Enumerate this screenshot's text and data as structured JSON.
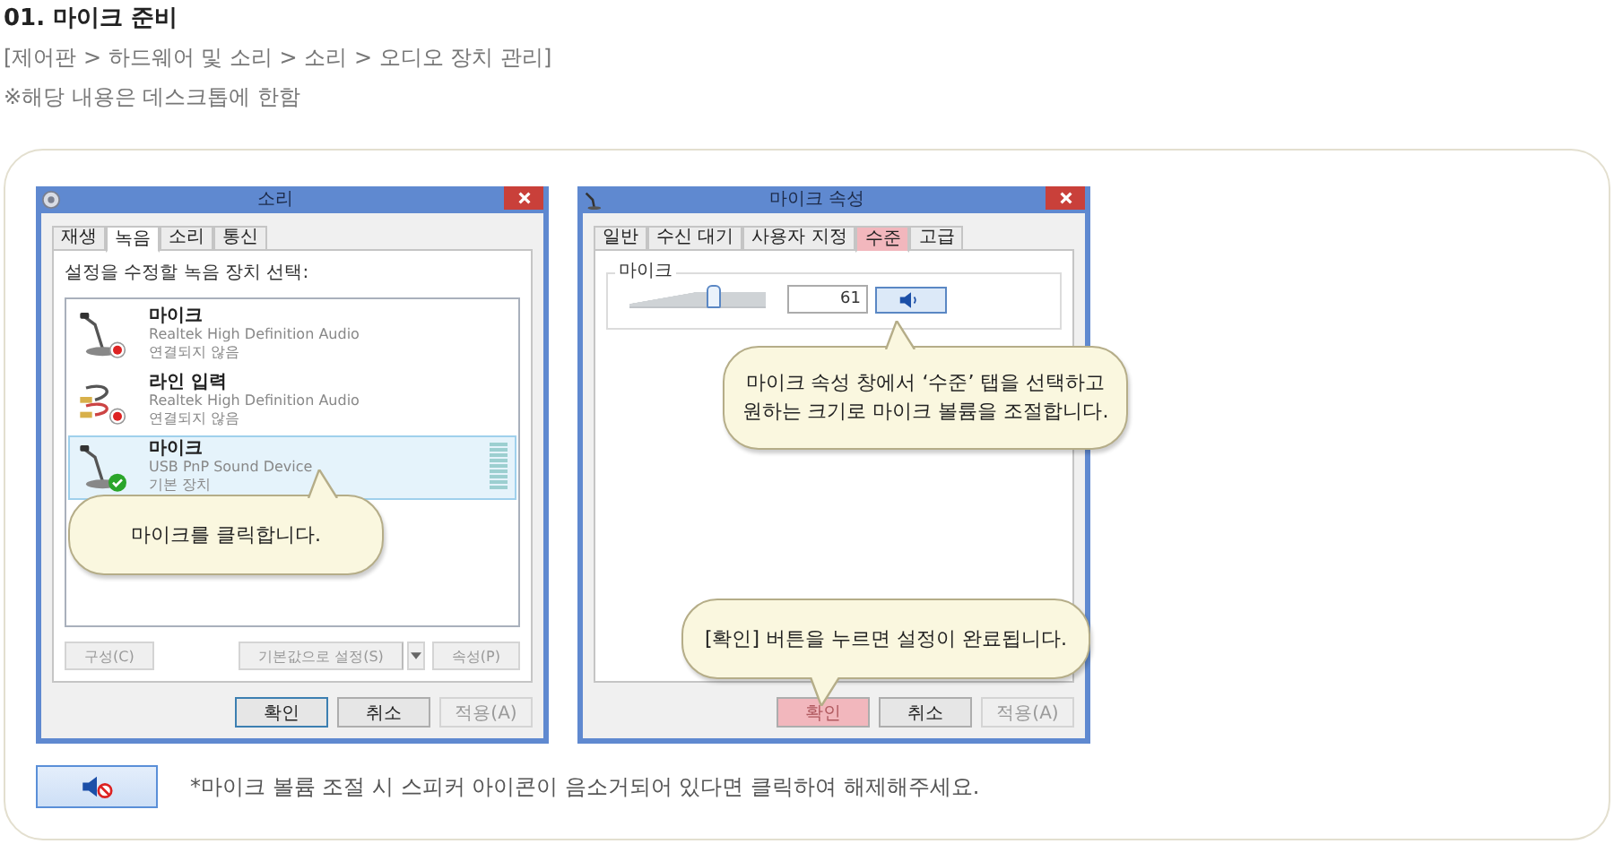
{
  "heading": {
    "title": "01. 마이크 준비",
    "path": "[제어판 > 하드웨어 및 소리 > 소리 > 오디오 장치 관리]",
    "note": "※해당 내용은 데스크톱에 한함"
  },
  "sound_window": {
    "title": "소리",
    "tabs": [
      {
        "label": "재생",
        "selected": false
      },
      {
        "label": "녹음",
        "selected": true
      },
      {
        "label": "소리",
        "selected": false
      },
      {
        "label": "통신",
        "selected": false
      }
    ],
    "instruction": "설정을 수정할 녹음 장치 선택:",
    "devices": [
      {
        "kind": "mic",
        "connected": false,
        "name": "마이크",
        "driver": "Realtek High Definition Audio",
        "status": "연결되지 않음",
        "selected": false
      },
      {
        "kind": "cable",
        "connected": false,
        "name": "라인 입력",
        "driver": "Realtek High Definition Audio",
        "status": "연결되지 않음",
        "selected": false
      },
      {
        "kind": "mic",
        "connected": true,
        "name": "마이크",
        "driver": "USB PnP Sound Device",
        "status": "기본 장치",
        "selected": true
      }
    ],
    "callouts": [
      "마이크를 클릭합니다."
    ],
    "panel_buttons": [
      {
        "label": "구성(C)",
        "disabled": true,
        "dropdown": false
      },
      {
        "label": "기본값으로 설정(S)",
        "disabled": true,
        "dropdown": true
      },
      {
        "label": "속성(P)",
        "disabled": true,
        "dropdown": false
      }
    ],
    "buttons": [
      {
        "label": "확인",
        "disabled": false,
        "default": true,
        "highlighted": false
      },
      {
        "label": "취소",
        "disabled": false,
        "default": false,
        "highlighted": false
      },
      {
        "label": "적용(A)",
        "disabled": true,
        "default": false,
        "highlighted": false
      }
    ]
  },
  "level_window": {
    "title": "마이크 속성",
    "tabs": [
      {
        "label": "일반",
        "selected": false,
        "highlighted": false
      },
      {
        "label": "수신 대기",
        "selected": false,
        "highlighted": false
      },
      {
        "label": "사용자 지정",
        "selected": false,
        "highlighted": false
      },
      {
        "label": "수준",
        "selected": true,
        "highlighted": true
      },
      {
        "label": "고급",
        "selected": false,
        "highlighted": false
      }
    ],
    "group": {
      "label": "마이크",
      "level": 0.61,
      "value": "61",
      "muted": false
    },
    "callouts": [
      "마이크 속성 창에서 ‘수준’ 탭을 선택하고 원하는 크기로 마이크 볼륨을 조절합니다.",
      "[확인] 버튼을 누르면 설정이 완료됩니다."
    ],
    "buttons": [
      {
        "label": "확인",
        "disabled": false,
        "default": false,
        "highlighted": true
      },
      {
        "label": "취소",
        "disabled": false,
        "default": false,
        "highlighted": false
      },
      {
        "label": "적용(A)",
        "disabled": true,
        "default": false,
        "highlighted": false
      }
    ]
  },
  "mute_tip": {
    "muted": true,
    "text": "*마이크 볼륨 조절 시 스피커 아이콘이 음소거되어 있다면 클릭하여 해제해주세요."
  }
}
